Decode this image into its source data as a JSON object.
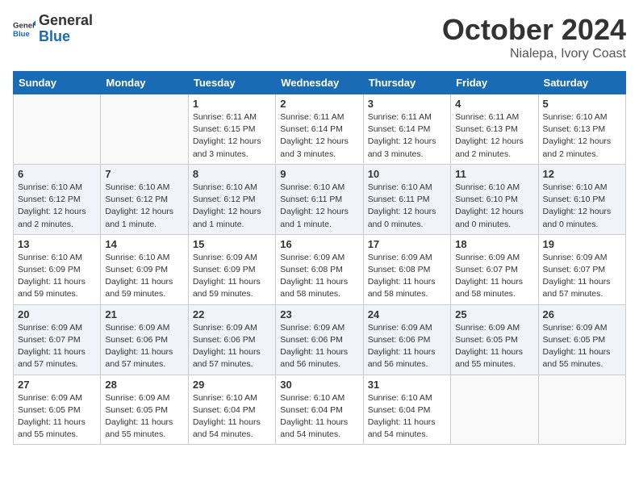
{
  "header": {
    "logo_general": "General",
    "logo_blue": "Blue",
    "month": "October 2024",
    "location": "Nialepa, Ivory Coast"
  },
  "days_of_week": [
    "Sunday",
    "Monday",
    "Tuesday",
    "Wednesday",
    "Thursday",
    "Friday",
    "Saturday"
  ],
  "weeks": [
    [
      {
        "day": "",
        "info": ""
      },
      {
        "day": "",
        "info": ""
      },
      {
        "day": "1",
        "info": "Sunrise: 6:11 AM\nSunset: 6:15 PM\nDaylight: 12 hours and 3 minutes."
      },
      {
        "day": "2",
        "info": "Sunrise: 6:11 AM\nSunset: 6:14 PM\nDaylight: 12 hours and 3 minutes."
      },
      {
        "day": "3",
        "info": "Sunrise: 6:11 AM\nSunset: 6:14 PM\nDaylight: 12 hours and 3 minutes."
      },
      {
        "day": "4",
        "info": "Sunrise: 6:11 AM\nSunset: 6:13 PM\nDaylight: 12 hours and 2 minutes."
      },
      {
        "day": "5",
        "info": "Sunrise: 6:10 AM\nSunset: 6:13 PM\nDaylight: 12 hours and 2 minutes."
      }
    ],
    [
      {
        "day": "6",
        "info": "Sunrise: 6:10 AM\nSunset: 6:12 PM\nDaylight: 12 hours and 2 minutes."
      },
      {
        "day": "7",
        "info": "Sunrise: 6:10 AM\nSunset: 6:12 PM\nDaylight: 12 hours and 1 minute."
      },
      {
        "day": "8",
        "info": "Sunrise: 6:10 AM\nSunset: 6:12 PM\nDaylight: 12 hours and 1 minute."
      },
      {
        "day": "9",
        "info": "Sunrise: 6:10 AM\nSunset: 6:11 PM\nDaylight: 12 hours and 1 minute."
      },
      {
        "day": "10",
        "info": "Sunrise: 6:10 AM\nSunset: 6:11 PM\nDaylight: 12 hours and 0 minutes."
      },
      {
        "day": "11",
        "info": "Sunrise: 6:10 AM\nSunset: 6:10 PM\nDaylight: 12 hours and 0 minutes."
      },
      {
        "day": "12",
        "info": "Sunrise: 6:10 AM\nSunset: 6:10 PM\nDaylight: 12 hours and 0 minutes."
      }
    ],
    [
      {
        "day": "13",
        "info": "Sunrise: 6:10 AM\nSunset: 6:09 PM\nDaylight: 11 hours and 59 minutes."
      },
      {
        "day": "14",
        "info": "Sunrise: 6:10 AM\nSunset: 6:09 PM\nDaylight: 11 hours and 59 minutes."
      },
      {
        "day": "15",
        "info": "Sunrise: 6:09 AM\nSunset: 6:09 PM\nDaylight: 11 hours and 59 minutes."
      },
      {
        "day": "16",
        "info": "Sunrise: 6:09 AM\nSunset: 6:08 PM\nDaylight: 11 hours and 58 minutes."
      },
      {
        "day": "17",
        "info": "Sunrise: 6:09 AM\nSunset: 6:08 PM\nDaylight: 11 hours and 58 minutes."
      },
      {
        "day": "18",
        "info": "Sunrise: 6:09 AM\nSunset: 6:07 PM\nDaylight: 11 hours and 58 minutes."
      },
      {
        "day": "19",
        "info": "Sunrise: 6:09 AM\nSunset: 6:07 PM\nDaylight: 11 hours and 57 minutes."
      }
    ],
    [
      {
        "day": "20",
        "info": "Sunrise: 6:09 AM\nSunset: 6:07 PM\nDaylight: 11 hours and 57 minutes."
      },
      {
        "day": "21",
        "info": "Sunrise: 6:09 AM\nSunset: 6:06 PM\nDaylight: 11 hours and 57 minutes."
      },
      {
        "day": "22",
        "info": "Sunrise: 6:09 AM\nSunset: 6:06 PM\nDaylight: 11 hours and 57 minutes."
      },
      {
        "day": "23",
        "info": "Sunrise: 6:09 AM\nSunset: 6:06 PM\nDaylight: 11 hours and 56 minutes."
      },
      {
        "day": "24",
        "info": "Sunrise: 6:09 AM\nSunset: 6:06 PM\nDaylight: 11 hours and 56 minutes."
      },
      {
        "day": "25",
        "info": "Sunrise: 6:09 AM\nSunset: 6:05 PM\nDaylight: 11 hours and 55 minutes."
      },
      {
        "day": "26",
        "info": "Sunrise: 6:09 AM\nSunset: 6:05 PM\nDaylight: 11 hours and 55 minutes."
      }
    ],
    [
      {
        "day": "27",
        "info": "Sunrise: 6:09 AM\nSunset: 6:05 PM\nDaylight: 11 hours and 55 minutes."
      },
      {
        "day": "28",
        "info": "Sunrise: 6:09 AM\nSunset: 6:05 PM\nDaylight: 11 hours and 55 minutes."
      },
      {
        "day": "29",
        "info": "Sunrise: 6:10 AM\nSunset: 6:04 PM\nDaylight: 11 hours and 54 minutes."
      },
      {
        "day": "30",
        "info": "Sunrise: 6:10 AM\nSunset: 6:04 PM\nDaylight: 11 hours and 54 minutes."
      },
      {
        "day": "31",
        "info": "Sunrise: 6:10 AM\nSunset: 6:04 PM\nDaylight: 11 hours and 54 minutes."
      },
      {
        "day": "",
        "info": ""
      },
      {
        "day": "",
        "info": ""
      }
    ]
  ]
}
